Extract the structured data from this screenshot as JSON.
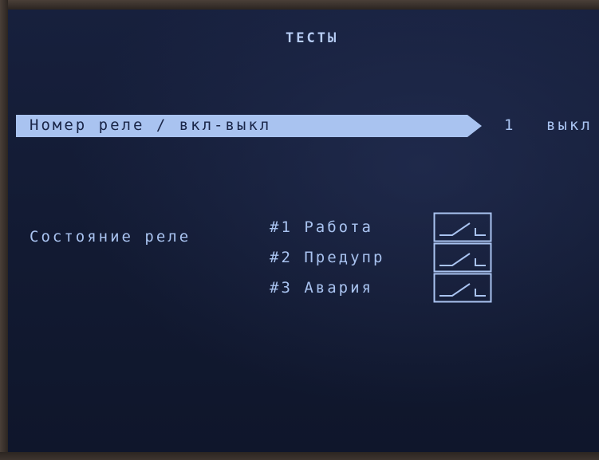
{
  "screen": {
    "title": "ТЕСТЫ",
    "menu": {
      "selected_label": "Номер реле / вкл-выкл",
      "relay_number": "1",
      "state": "выкл"
    },
    "relay_status": {
      "label": "Состояние реле",
      "relays": [
        {
          "label": "#1 Работа",
          "icon": "relay-open-contact-icon"
        },
        {
          "label": "#2 Предупр",
          "icon": "relay-open-contact-icon"
        },
        {
          "label": "#3 Авария",
          "icon": "relay-open-contact-icon"
        }
      ]
    }
  },
  "colors": {
    "background": "#131b33",
    "text": "#a9c3f0",
    "highlight": "#a9c3f0",
    "highlight_text": "#1a2648"
  }
}
